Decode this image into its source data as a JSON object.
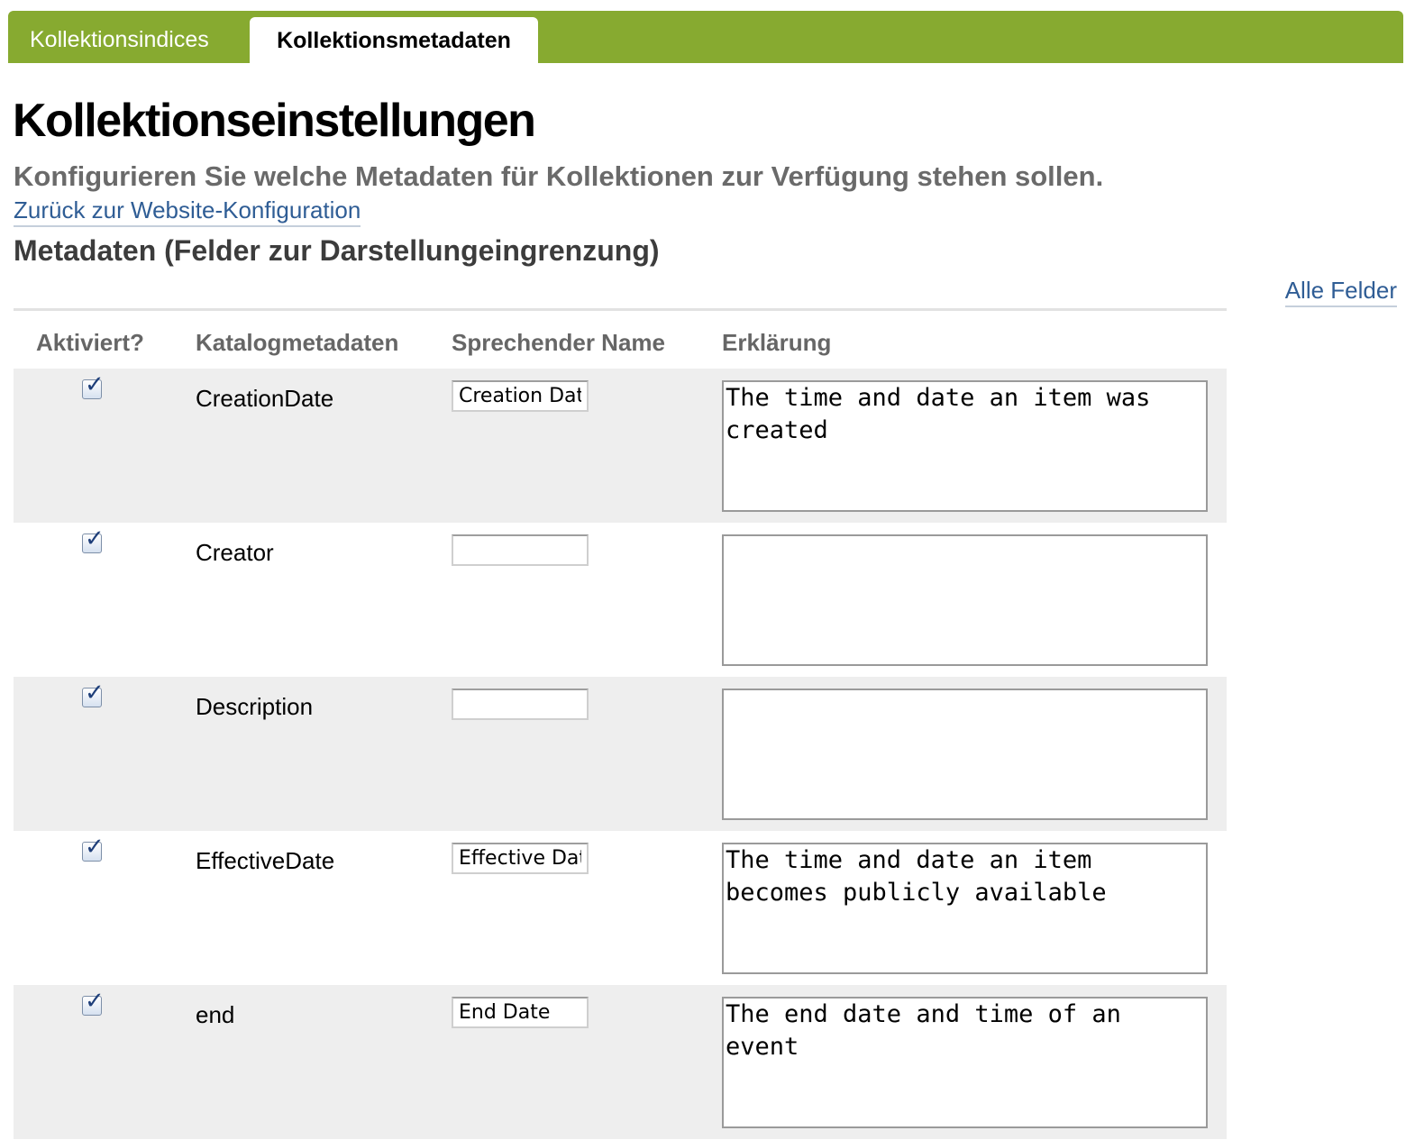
{
  "tabs": [
    {
      "label": "Kollektionsindices",
      "active": false
    },
    {
      "label": "Kollektionsmetadaten",
      "active": true
    }
  ],
  "page": {
    "title": "Kollektionseinstellungen",
    "subtitle": "Konfigurieren Sie welche Metadaten für Kollektionen zur Verfügung stehen sollen.",
    "back_link": "Zurück zur Website-Konfiguration",
    "section_title": "Metadaten (Felder zur Darstellungeingrenzung)",
    "all_fields_link": "Alle Felder"
  },
  "table": {
    "headers": {
      "enabled": "Aktiviert?",
      "catalog": "Katalogmetadaten",
      "friendly": "Sprechender Name",
      "description": "Erklärung"
    },
    "rows": [
      {
        "enabled": true,
        "field": "CreationDate",
        "friendly_name": "Creation Date",
        "description": "The time and date an item was created"
      },
      {
        "enabled": true,
        "field": "Creator",
        "friendly_name": "",
        "description": ""
      },
      {
        "enabled": true,
        "field": "Description",
        "friendly_name": "",
        "description": ""
      },
      {
        "enabled": true,
        "field": "EffectiveDate",
        "friendly_name": "Effective Date",
        "description": "The time and date an item becomes publicly available"
      },
      {
        "enabled": true,
        "field": "end",
        "friendly_name": "End Date",
        "description": "The end date and time of an event"
      }
    ]
  },
  "colors": {
    "tabbar": "#87aa30",
    "link": "#2f5d95",
    "row_alt": "#eeeeee"
  }
}
